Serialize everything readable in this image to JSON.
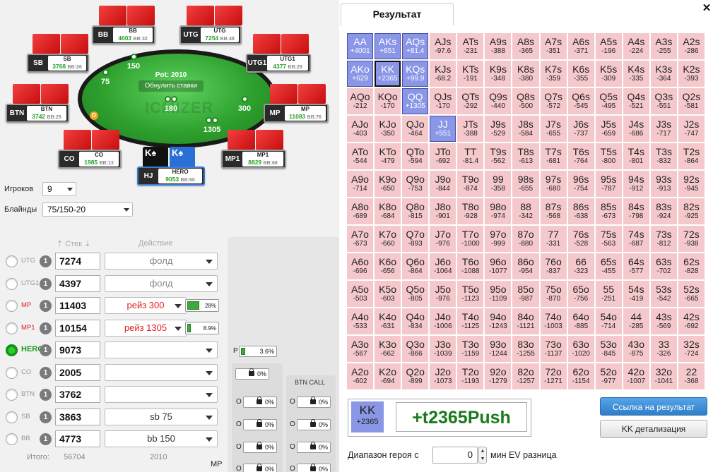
{
  "table": {
    "watermark": "ICMIZER",
    "pot_label": "Pot: 2010",
    "refresh_button": "Обнулить ставки",
    "bets": {
      "bb": "150",
      "sb": "75",
      "center": "180",
      "mp": "300",
      "mp1": "1305"
    },
    "dealer": "D",
    "seats": [
      {
        "id": "bb",
        "pos": "BB",
        "name": "BB",
        "stack": "4603",
        "bb": "BB:32"
      },
      {
        "id": "utg",
        "pos": "UTG",
        "name": "UTG",
        "stack": "7254",
        "bb": "BB:48"
      },
      {
        "id": "sb",
        "pos": "SB",
        "name": "SB",
        "stack": "3768",
        "bb": "BB:26"
      },
      {
        "id": "utg1",
        "pos": "UTG1",
        "name": "UTG1",
        "stack": "4377",
        "bb": "BB:29"
      },
      {
        "id": "btn",
        "pos": "BTN",
        "name": "BTN",
        "stack": "3742",
        "bb": "BB:25"
      },
      {
        "id": "mp",
        "pos": "MP",
        "name": "MP",
        "stack": "11083",
        "bb": "BB:76"
      },
      {
        "id": "co",
        "pos": "CO",
        "name": "CO",
        "stack": "1985",
        "bb": "BB:13"
      },
      {
        "id": "mp1",
        "pos": "MP1",
        "name": "MP1",
        "stack": "8829",
        "bb": "BB:68"
      },
      {
        "id": "hero",
        "pos": "HJ",
        "name": "HERO",
        "stack": "9053",
        "bb": "BB:60"
      }
    ],
    "hero_cards": [
      "K♠",
      "K♠"
    ]
  },
  "controls": {
    "players_label": "Игроков",
    "players_value": "9",
    "blinds_label": "Блайнды",
    "blinds_value": "75/150-20",
    "stack_header": "Стек",
    "action_header": "Действие"
  },
  "players": [
    {
      "pos": "UTG",
      "stack": "7274",
      "action": "фолд",
      "pct": "",
      "fill": 0
    },
    {
      "pos": "UTG1",
      "stack": "4397",
      "action": "фолд",
      "pct": "",
      "fill": 0
    },
    {
      "pos": "MP",
      "stack": "11403",
      "action": "рейз 300",
      "pct": "28%",
      "fill": 0.28
    },
    {
      "pos": "MP1",
      "stack": "10154",
      "action": "рейз 1305",
      "pct": "8.9%",
      "fill": 0.089
    },
    {
      "pos": "HERO",
      "stack": "9073",
      "action": "",
      "pct": "",
      "fill": 0
    },
    {
      "pos": "CO",
      "stack": "2005",
      "action": "",
      "pct": "",
      "fill": 0
    },
    {
      "pos": "BTN",
      "stack": "3762",
      "action": "",
      "pct": "",
      "fill": 0
    },
    {
      "pos": "SB",
      "stack": "3863",
      "action": "sb 75",
      "pct": "",
      "fill": 0
    },
    {
      "pos": "BB",
      "stack": "4773",
      "action": "bb 150",
      "pct": "",
      "fill": 0
    }
  ],
  "player_badge": "1",
  "totals": {
    "label": "Итого:",
    "stack": "56704",
    "action": "2010",
    "pos": "MP"
  },
  "side": {
    "p_label": "P",
    "p_value": "3.6%",
    "btn_call_label": "BTN CALL",
    "o_label": "O",
    "zero": "0%"
  },
  "result": {
    "tab": "Результат",
    "close": "✕",
    "hand": "KK",
    "hand_ev": "+2365",
    "verdict": "+t2365Push",
    "link_button": "Ссылка на результат",
    "detail_button": "KK детализация",
    "range_label": "Диапазон героя с",
    "range_value": "0",
    "range_label2": "мин EV разница"
  },
  "grid": [
    [
      [
        "AA",
        "+4001",
        1
      ],
      [
        "AKs",
        "+851",
        1
      ],
      [
        "AQs",
        "+81.4",
        1
      ],
      [
        "AJs",
        "-97.6",
        0
      ],
      [
        "ATs",
        "-231",
        0
      ],
      [
        "A9s",
        "-388",
        0
      ],
      [
        "A8s",
        "-365",
        0
      ],
      [
        "A7s",
        "-351",
        0
      ],
      [
        "A6s",
        "-371",
        0
      ],
      [
        "A5s",
        "-196",
        0
      ],
      [
        "A4s",
        "-224",
        0
      ],
      [
        "A3s",
        "-255",
        0
      ],
      [
        "A2s",
        "-286",
        0
      ]
    ],
    [
      [
        "AKo",
        "+629",
        1
      ],
      [
        "KK",
        "+2365",
        2
      ],
      [
        "KQs",
        "+99.9",
        1
      ],
      [
        "KJs",
        "-68.2",
        0
      ],
      [
        "KTs",
        "-191",
        0
      ],
      [
        "K9s",
        "-348",
        0
      ],
      [
        "K8s",
        "-380",
        0
      ],
      [
        "K7s",
        "-359",
        0
      ],
      [
        "K6s",
        "-355",
        0
      ],
      [
        "K5s",
        "-309",
        0
      ],
      [
        "K4s",
        "-335",
        0
      ],
      [
        "K3s",
        "-364",
        0
      ],
      [
        "K2s",
        "-393",
        0
      ]
    ],
    [
      [
        "AQo",
        "-212",
        0
      ],
      [
        "KQo",
        "-170",
        0
      ],
      [
        "QQ",
        "+1305",
        1
      ],
      [
        "QJs",
        "-170",
        0
      ],
      [
        "QTs",
        "-292",
        0
      ],
      [
        "Q9s",
        "-440",
        0
      ],
      [
        "Q8s",
        "-500",
        0
      ],
      [
        "Q7s",
        "-572",
        0
      ],
      [
        "Q6s",
        "-545",
        0
      ],
      [
        "Q5s",
        "-495",
        0
      ],
      [
        "Q4s",
        "-521",
        0
      ],
      [
        "Q3s",
        "-551",
        0
      ],
      [
        "Q2s",
        "-581",
        0
      ]
    ],
    [
      [
        "AJo",
        "-403",
        0
      ],
      [
        "KJo",
        "-350",
        0
      ],
      [
        "QJo",
        "-464",
        0
      ],
      [
        "JJ",
        "+551",
        1
      ],
      [
        "JTs",
        "-388",
        0
      ],
      [
        "J9s",
        "-529",
        0
      ],
      [
        "J8s",
        "-584",
        0
      ],
      [
        "J7s",
        "-655",
        0
      ],
      [
        "J6s",
        "-737",
        0
      ],
      [
        "J5s",
        "-659",
        0
      ],
      [
        "J4s",
        "-686",
        0
      ],
      [
        "J3s",
        "-717",
        0
      ],
      [
        "J2s",
        "-747",
        0
      ]
    ],
    [
      [
        "ATo",
        "-544",
        0
      ],
      [
        "KTo",
        "-479",
        0
      ],
      [
        "QTo",
        "-594",
        0
      ],
      [
        "JTo",
        "-692",
        0
      ],
      [
        "TT",
        "-81.4",
        0
      ],
      [
        "T9s",
        "-562",
        0
      ],
      [
        "T8s",
        "-613",
        0
      ],
      [
        "T7s",
        "-681",
        0
      ],
      [
        "T6s",
        "-764",
        0
      ],
      [
        "T5s",
        "-800",
        0
      ],
      [
        "T4s",
        "-801",
        0
      ],
      [
        "T3s",
        "-832",
        0
      ],
      [
        "T2s",
        "-864",
        0
      ]
    ],
    [
      [
        "A9o",
        "-714",
        0
      ],
      [
        "K9o",
        "-650",
        0
      ],
      [
        "Q9o",
        "-753",
        0
      ],
      [
        "J9o",
        "-844",
        0
      ],
      [
        "T9o",
        "-874",
        0
      ],
      [
        "99",
        "-358",
        0
      ],
      [
        "98s",
        "-655",
        0
      ],
      [
        "97s",
        "-680",
        0
      ],
      [
        "96s",
        "-754",
        0
      ],
      [
        "95s",
        "-787",
        0
      ],
      [
        "94s",
        "-912",
        0
      ],
      [
        "93s",
        "-913",
        0
      ],
      [
        "92s",
        "-945",
        0
      ]
    ],
    [
      [
        "A8o",
        "-689",
        0
      ],
      [
        "K8o",
        "-684",
        0
      ],
      [
        "Q8o",
        "-815",
        0
      ],
      [
        "J8o",
        "-901",
        0
      ],
      [
        "T8o",
        "-928",
        0
      ],
      [
        "98o",
        "-974",
        0
      ],
      [
        "88",
        "-342",
        0
      ],
      [
        "87s",
        "-568",
        0
      ],
      [
        "86s",
        "-638",
        0
      ],
      [
        "85s",
        "-673",
        0
      ],
      [
        "84s",
        "-798",
        0
      ],
      [
        "83s",
        "-924",
        0
      ],
      [
        "82s",
        "-925",
        0
      ]
    ],
    [
      [
        "A7o",
        "-673",
        0
      ],
      [
        "K7o",
        "-660",
        0
      ],
      [
        "Q7o",
        "-893",
        0
      ],
      [
        "J7o",
        "-976",
        0
      ],
      [
        "T7o",
        "-1000",
        0
      ],
      [
        "97o",
        "-999",
        0
      ],
      [
        "87o",
        "-880",
        0
      ],
      [
        "77",
        "-331",
        0
      ],
      [
        "76s",
        "-528",
        0
      ],
      [
        "75s",
        "-563",
        0
      ],
      [
        "74s",
        "-687",
        0
      ],
      [
        "73s",
        "-812",
        0
      ],
      [
        "72s",
        "-938",
        0
      ]
    ],
    [
      [
        "A6o",
        "-696",
        0
      ],
      [
        "K6o",
        "-656",
        0
      ],
      [
        "Q6o",
        "-864",
        0
      ],
      [
        "J6o",
        "-1064",
        0
      ],
      [
        "T6o",
        "-1088",
        0
      ],
      [
        "96o",
        "-1077",
        0
      ],
      [
        "86o",
        "-954",
        0
      ],
      [
        "76o",
        "-837",
        0
      ],
      [
        "66",
        "-323",
        0
      ],
      [
        "65s",
        "-455",
        0
      ],
      [
        "64s",
        "-577",
        0
      ],
      [
        "63s",
        "-702",
        0
      ],
      [
        "62s",
        "-828",
        0
      ]
    ],
    [
      [
        "A5o",
        "-503",
        0
      ],
      [
        "K5o",
        "-603",
        0
      ],
      [
        "Q5o",
        "-805",
        0
      ],
      [
        "J5o",
        "-976",
        0
      ],
      [
        "T5o",
        "-1123",
        0
      ],
      [
        "95o",
        "-1109",
        0
      ],
      [
        "85o",
        "-987",
        0
      ],
      [
        "75o",
        "-870",
        0
      ],
      [
        "65o",
        "-756",
        0
      ],
      [
        "55",
        "-251",
        0
      ],
      [
        "54s",
        "-419",
        0
      ],
      [
        "53s",
        "-542",
        0
      ],
      [
        "52s",
        "-665",
        0
      ]
    ],
    [
      [
        "A4o",
        "-533",
        0
      ],
      [
        "K4o",
        "-631",
        0
      ],
      [
        "Q4o",
        "-834",
        0
      ],
      [
        "J4o",
        "-1006",
        0
      ],
      [
        "T4o",
        "-1125",
        0
      ],
      [
        "94o",
        "-1243",
        0
      ],
      [
        "84o",
        "-1121",
        0
      ],
      [
        "74o",
        "-1003",
        0
      ],
      [
        "64o",
        "-885",
        0
      ],
      [
        "54o",
        "-714",
        0
      ],
      [
        "44",
        "-285",
        0
      ],
      [
        "43s",
        "-569",
        0
      ],
      [
        "42s",
        "-692",
        0
      ]
    ],
    [
      [
        "A3o",
        "-567",
        0
      ],
      [
        "K3o",
        "-662",
        0
      ],
      [
        "Q3o",
        "-866",
        0
      ],
      [
        "J3o",
        "-1039",
        0
      ],
      [
        "T3o",
        "-1159",
        0
      ],
      [
        "93o",
        "-1244",
        0
      ],
      [
        "83o",
        "-1255",
        0
      ],
      [
        "73o",
        "-1137",
        0
      ],
      [
        "63o",
        "-1020",
        0
      ],
      [
        "53o",
        "-845",
        0
      ],
      [
        "43o",
        "-875",
        0
      ],
      [
        "33",
        "-326",
        0
      ],
      [
        "32s",
        "-724",
        0
      ]
    ],
    [
      [
        "A2o",
        "-602",
        0
      ],
      [
        "K2o",
        "-694",
        0
      ],
      [
        "Q2o",
        "-899",
        0
      ],
      [
        "J2o",
        "-1073",
        0
      ],
      [
        "T2o",
        "-1193",
        0
      ],
      [
        "92o",
        "-1279",
        0
      ],
      [
        "82o",
        "-1257",
        0
      ],
      [
        "72o",
        "-1271",
        0
      ],
      [
        "62o",
        "-1154",
        0
      ],
      [
        "52o",
        "-977",
        0
      ],
      [
        "42o",
        "-1007",
        0
      ],
      [
        "32o",
        "-1041",
        0
      ],
      [
        "22",
        "-368",
        0
      ]
    ]
  ]
}
